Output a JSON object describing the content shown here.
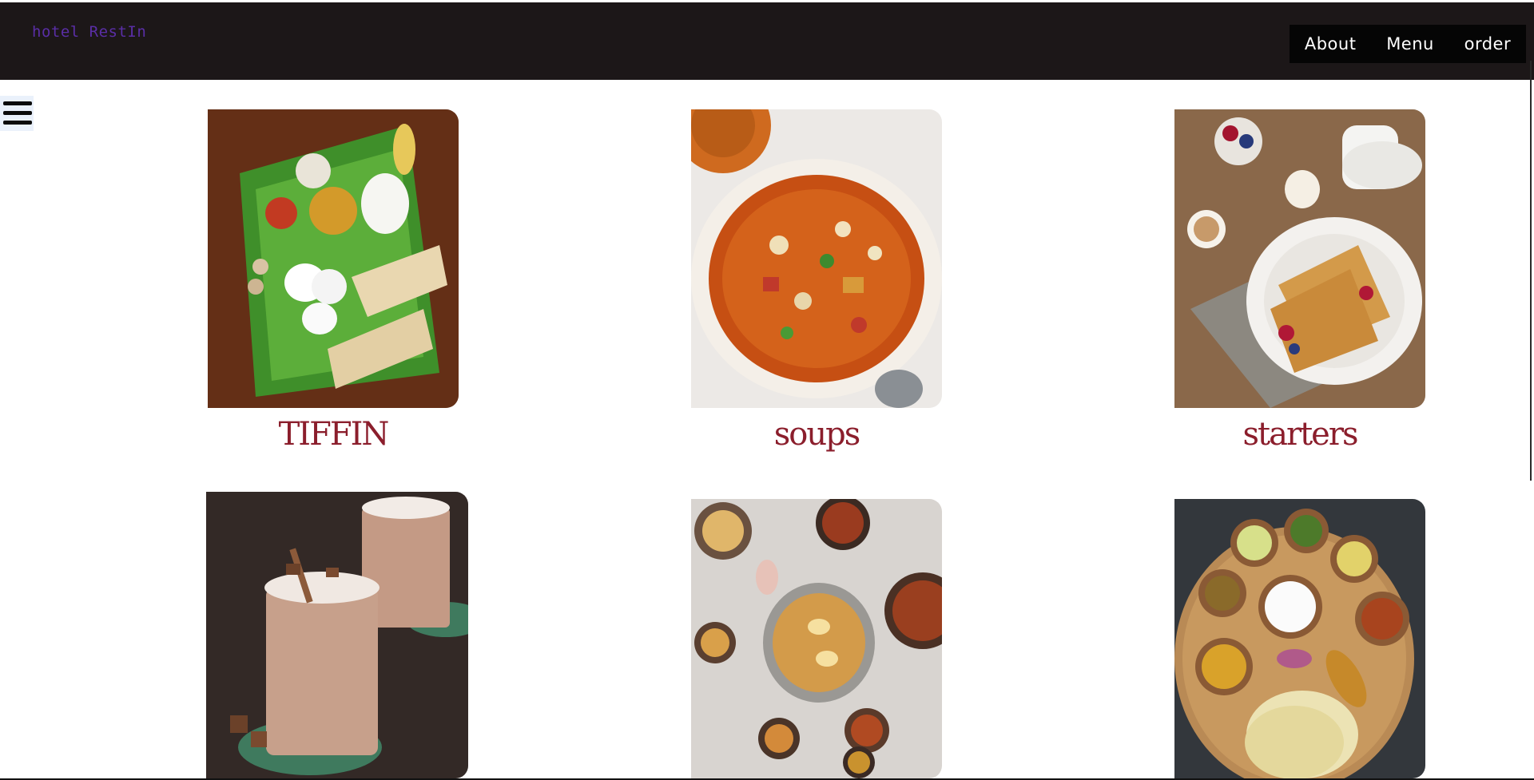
{
  "header": {
    "brand": "hotel RestIn",
    "nav": [
      {
        "label": "About"
      },
      {
        "label": "Menu"
      },
      {
        "label": "order"
      }
    ]
  },
  "menu_icon": "hamburger-menu-icon",
  "categories": [
    {
      "label": "TIFFIN",
      "image": "south-indian-tiffin-plate-photo"
    },
    {
      "label": "soups",
      "image": "vegetable-pasta-soup-photo"
    },
    {
      "label": "starters",
      "image": "waffles-with-berries-photo"
    },
    {
      "label": "",
      "image": "chocolate-milkshake-photo"
    },
    {
      "label": "",
      "image": "biryani-spread-photo"
    },
    {
      "label": "",
      "image": "thali-plate-photo"
    }
  ],
  "colors": {
    "header_bg": "#1c1718",
    "brand_text": "#5a2ea6",
    "nav_bg": "#050505",
    "label_text": "#8b1e2c"
  }
}
